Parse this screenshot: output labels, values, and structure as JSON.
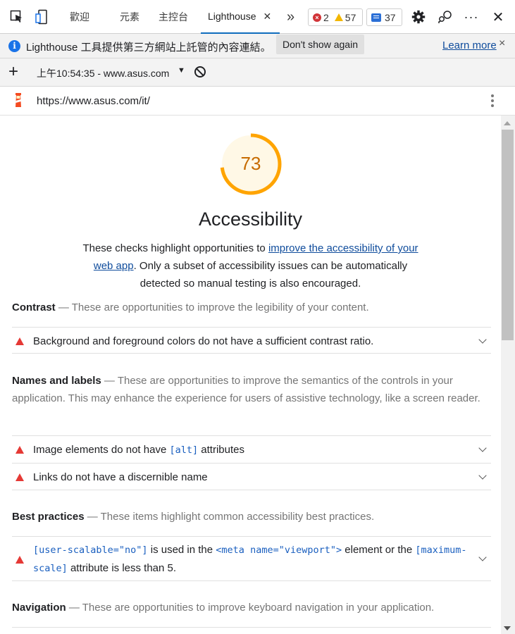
{
  "devtools": {
    "tabs": [
      {
        "label": "歡迎"
      },
      {
        "label": "元素"
      },
      {
        "label": "主控台"
      },
      {
        "label": "Lighthouse",
        "active": true
      }
    ],
    "more_tabs_glyph": "»",
    "issues": {
      "errors": "2",
      "warnings": "57",
      "messages": "37"
    },
    "colors": {
      "accent": "#0f6cbd",
      "error": "#d13438",
      "warning": "#f2b600",
      "link": "#0f4c9c",
      "score_average": "#ffa400"
    }
  },
  "infobar": {
    "text": "Lighthouse 工具提供第三方網站上託管的內容連結。",
    "dont_show_label": "Don't show again",
    "learn_more_label": "Learn more",
    "close_glyph": "×"
  },
  "toolbar": {
    "add_glyph": "+",
    "report_label": "上午10:54:35 - www.asus.com",
    "caret": "▼"
  },
  "urlbar": {
    "url": "https://www.asus.com/it/"
  },
  "report": {
    "score": "73",
    "score_fraction": 0.73,
    "category_title": "Accessibility",
    "description": {
      "before": "These checks highlight opportunities to ",
      "link": "improve the accessibility of your web app",
      "after": ". Only a subset of accessibility issues can be automatically detected so manual testing is also encouraged."
    },
    "groups": [
      {
        "title": "Contrast",
        "sep": " — ",
        "desc": "These are opportunities to improve the legibility of your content.",
        "audits": [
          {
            "text": "Background and foreground colors do not have a sufficient contrast ratio."
          }
        ]
      },
      {
        "title": "Names and labels",
        "sep": " — ",
        "desc": "These are opportunities to improve the semantics of the controls in your application. This may enhance the experience for users of assistive technology, like a screen reader.",
        "audits": [
          {
            "pre": "Image elements do not have ",
            "code": "[alt]",
            "post": " attributes"
          },
          {
            "text": "Links do not have a discernible name"
          }
        ]
      },
      {
        "title": "Best practices",
        "sep": " — ",
        "desc": "These items highlight common accessibility best practices.",
        "audits": [
          {
            "code1": "[user-scalable=\"no\"]",
            "mid1": " is used in the ",
            "code2": "<meta name=\"viewport\">",
            "mid2": " element or the ",
            "code3": "[maximum-scale]",
            "post": " attribute is less than 5."
          }
        ]
      },
      {
        "title": "Navigation",
        "sep": " — ",
        "desc": "These are opportunities to improve keyboard navigation in your application."
      }
    ]
  }
}
